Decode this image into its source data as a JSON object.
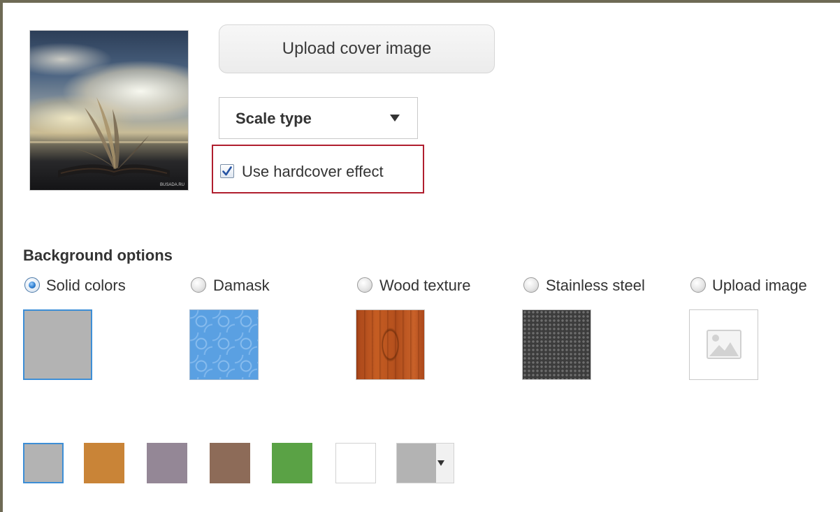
{
  "cover": {
    "upload_button_label": "Upload cover image",
    "thumbnail_watermark": "BUSADA.RU",
    "scale_type_label": "Scale type",
    "hardcover_label": "Use hardcover effect",
    "hardcover_checked": true
  },
  "background": {
    "title": "Background options",
    "selected": "Solid colors",
    "options": [
      {
        "label": "Solid colors",
        "checked": true
      },
      {
        "label": "Damask",
        "checked": false
      },
      {
        "label": "Wood texture",
        "checked": false
      },
      {
        "label": "Stainless steel",
        "checked": false
      },
      {
        "label": "Upload image",
        "checked": false
      }
    ],
    "solid_colors": [
      "#b3b3b3",
      "#c98437",
      "#948796",
      "#8d6b58",
      "#5aa245",
      "#ffffff"
    ],
    "custom_color": "#b3b3b3",
    "selected_color": "#b3b3b3"
  },
  "colors": {
    "selection_border": "#3d8ed6",
    "highlight_border": "#b01e2e",
    "frame": "#6e6a55"
  }
}
